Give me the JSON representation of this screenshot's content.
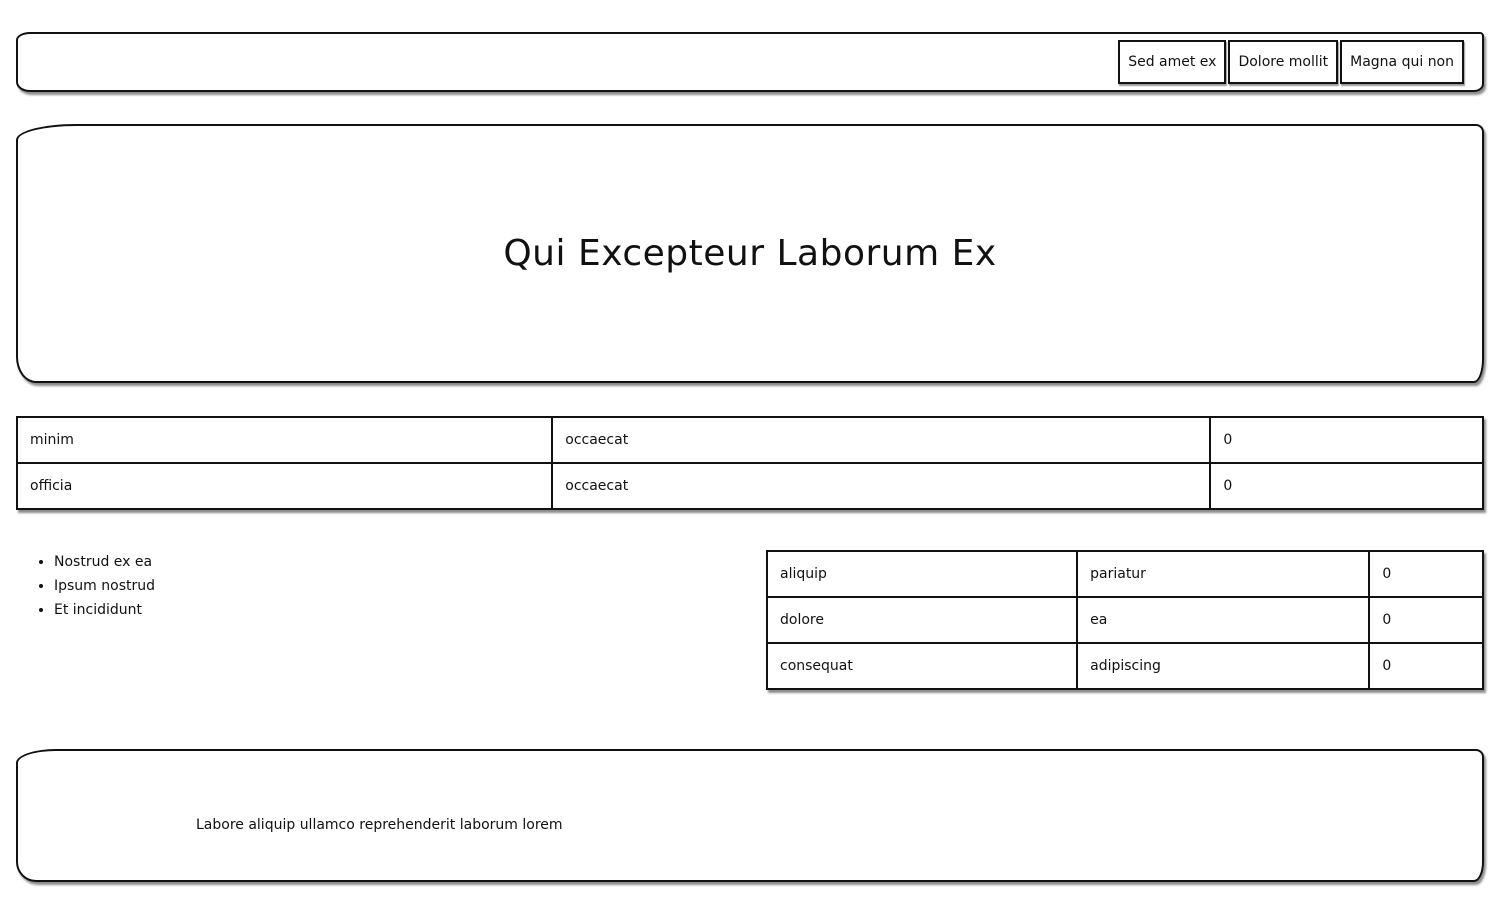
{
  "nav": {
    "buttons": [
      {
        "label": "Sed amet ex"
      },
      {
        "label": "Dolore mollit"
      },
      {
        "label": "Magna qui non"
      }
    ]
  },
  "hero": {
    "title": "Qui Excepteur Laborum Ex"
  },
  "table1": {
    "rows": [
      [
        "minim",
        "occaecat",
        "0"
      ],
      [
        "officia",
        "occaecat",
        "0"
      ]
    ]
  },
  "list": {
    "items": [
      "Nostrud ex ea",
      "Ipsum nostrud",
      "Et incididunt"
    ]
  },
  "table2": {
    "rows": [
      [
        "aliquip",
        "pariatur",
        "0"
      ],
      [
        "dolore",
        "ea",
        "0"
      ],
      [
        "consequat",
        "adipiscing",
        "0"
      ]
    ]
  },
  "footer": {
    "text": "Labore aliquip ullamco reprehenderit laborum lorem"
  }
}
